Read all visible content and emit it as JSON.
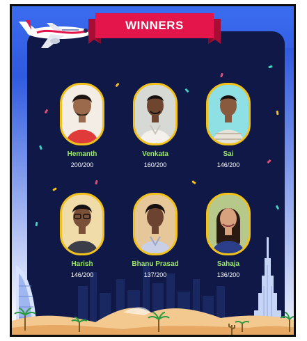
{
  "header": {
    "title": "WINNERS"
  },
  "winners": [
    {
      "name": "Hemanth",
      "score": "200/200"
    },
    {
      "name": "Venkata",
      "score": "160/200"
    },
    {
      "name": "Sai",
      "score": "146/200"
    },
    {
      "name": "Harish",
      "score": "146/200"
    },
    {
      "name": "Bhanu Prasad",
      "score": "137/200"
    },
    {
      "name": "Sahaja",
      "score": "136/200"
    }
  ],
  "colors": {
    "panel": "#0f1846",
    "background": "#2f53d6",
    "banner": "#e4154b",
    "photo_border": "#f2c21b",
    "name_text": "#9be86b",
    "score_text": "#ffffff"
  },
  "icons": {
    "airplane": "airplane-icon",
    "skyline": "dubai-skyline-illustration",
    "palm": "palm-tree-icon"
  }
}
